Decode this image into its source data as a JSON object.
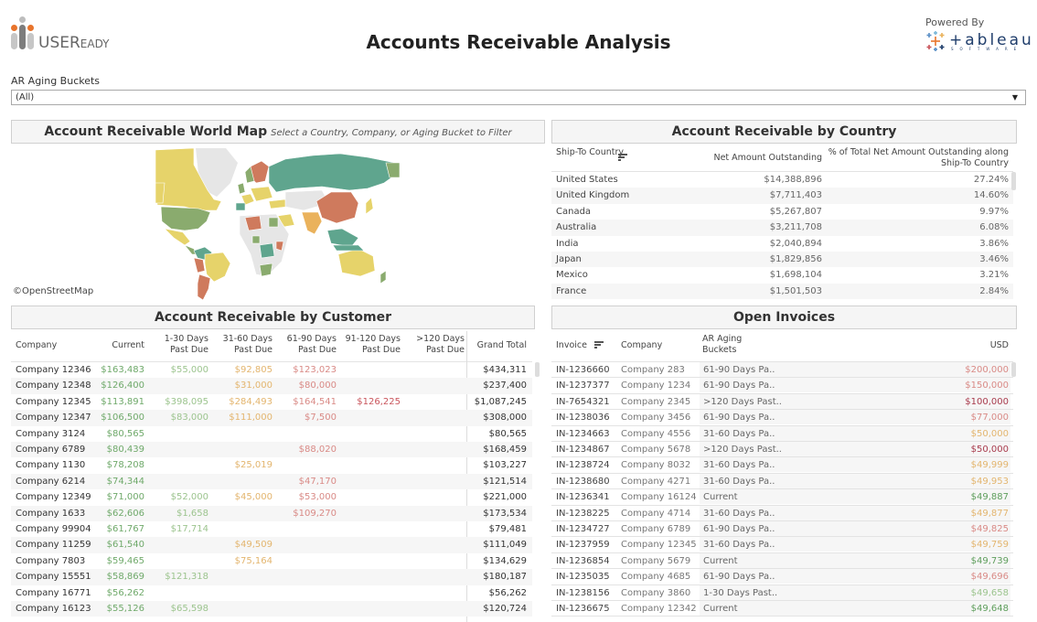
{
  "header": {
    "logo_text_main": "USER",
    "logo_text_small": "EADY",
    "title": "Accounts Receivable Analysis",
    "powered_by": "Powered By",
    "tableau_text": "+ableau",
    "tableau_sub": "SOFTWARE"
  },
  "filter": {
    "label": "AR Aging Buckets",
    "value": "(All)",
    "arrow": "▼"
  },
  "map": {
    "title": "Account Receivable World Map",
    "subtitle": "Select a Country, Company, or Aging Bucket to Filter",
    "credit": "©OpenStreetMap",
    "colors": {
      "current": "#5fa58e",
      "green": "#8aab6e",
      "yellow": "#e6d36a",
      "orange": "#eab25c",
      "red": "#cf7a5d",
      "nodata": "#e6e6e6"
    }
  },
  "country": {
    "title": "Account Receivable by Country",
    "headers": {
      "country": "Ship-To Country",
      "net": "Net Amount Outstanding",
      "pct": "% of Total Net Amount Outstanding along Ship-To Country"
    },
    "rows": [
      {
        "country": "United States",
        "net": "$14,388,896",
        "pct": "27.24%"
      },
      {
        "country": "United Kingdom",
        "net": "$7,711,403",
        "pct": "14.60%"
      },
      {
        "country": "Canada",
        "net": "$5,267,807",
        "pct": "9.97%"
      },
      {
        "country": "Australia",
        "net": "$3,211,708",
        "pct": "6.08%"
      },
      {
        "country": "India",
        "net": "$2,040,894",
        "pct": "3.86%"
      },
      {
        "country": "Japan",
        "net": "$1,829,856",
        "pct": "3.46%"
      },
      {
        "country": "Mexico",
        "net": "$1,698,104",
        "pct": "3.21%"
      },
      {
        "country": "France",
        "net": "$1,501,503",
        "pct": "2.84%"
      }
    ]
  },
  "customer": {
    "title": "Account Receivable by Customer",
    "headers": [
      "Company",
      "Current",
      "1-30 Days Past Due",
      "31-60 Days Past Due",
      "61-90 Days Past Due",
      "91-120 Days Past Due",
      ">120 Days Past Due",
      "Grand Total"
    ],
    "column_colors": [
      "#333333",
      "#6fa96a",
      "#9cc48e",
      "#e3b56e",
      "#d98a86",
      "#c9555c",
      "#a83a4c",
      "#333333"
    ],
    "rows": [
      [
        "Company 12346",
        "$163,483",
        "$55,000",
        "$92,805",
        "$123,023",
        "",
        "",
        "$434,311"
      ],
      [
        "Company 12348",
        "$126,400",
        "",
        "$31,000",
        "$80,000",
        "",
        "",
        "$237,400"
      ],
      [
        "Company 12345",
        "$113,891",
        "$398,095",
        "$284,493",
        "$164,541",
        "$126,225",
        "",
        "$1,087,245"
      ],
      [
        "Company 12347",
        "$106,500",
        "$83,000",
        "$111,000",
        "$7,500",
        "",
        "",
        "$308,000"
      ],
      [
        "Company 3124",
        "$80,565",
        "",
        "",
        "",
        "",
        "",
        "$80,565"
      ],
      [
        "Company 6789",
        "$80,439",
        "",
        "",
        "$88,020",
        "",
        "",
        "$168,459"
      ],
      [
        "Company 1130",
        "$78,208",
        "",
        "$25,019",
        "",
        "",
        "",
        "$103,227"
      ],
      [
        "Company 6214",
        "$74,344",
        "",
        "",
        "$47,170",
        "",
        "",
        "$121,514"
      ],
      [
        "Company 12349",
        "$71,000",
        "$52,000",
        "$45,000",
        "$53,000",
        "",
        "",
        "$221,000"
      ],
      [
        "Company 1633",
        "$62,606",
        "$1,658",
        "",
        "$109,270",
        "",
        "",
        "$173,534"
      ],
      [
        "Company 99904",
        "$61,767",
        "$17,714",
        "",
        "",
        "",
        "",
        "$79,481"
      ],
      [
        "Company 11259",
        "$61,540",
        "",
        "$49,509",
        "",
        "",
        "",
        "$111,049"
      ],
      [
        "Company 7803",
        "$59,465",
        "",
        "$75,164",
        "",
        "",
        "",
        "$134,629"
      ],
      [
        "Company 15551",
        "$58,869",
        "$121,318",
        "",
        "",
        "",
        "",
        "$180,187"
      ],
      [
        "Company 16771",
        "$56,262",
        "",
        "",
        "",
        "",
        "",
        "$56,262"
      ],
      [
        "Company 16123",
        "$55,126",
        "$65,598",
        "",
        "",
        "",
        "",
        "$120,724"
      ]
    ]
  },
  "invoices": {
    "title": "Open Invoices",
    "headers": {
      "invoice": "Invoice",
      "company": "Company",
      "bucket": "AR Aging Buckets",
      "usd": "USD"
    },
    "bucket_colors": {
      "Current": "#5e9e5c",
      "1-30": "#9cc48e",
      "31-60": "#e3b56e",
      "61-90": "#d98a86",
      ">120": "#a83a4c"
    },
    "rows": [
      {
        "invoice": "IN-1236660",
        "company": "Company 283",
        "bucket": "61-90 Days Pa..",
        "usd": "$200,000",
        "key": "61-90"
      },
      {
        "invoice": "IN-1237377",
        "company": "Company 1234",
        "bucket": "61-90 Days Pa..",
        "usd": "$150,000",
        "key": "61-90"
      },
      {
        "invoice": "IN-7654321",
        "company": "Company 2345",
        "bucket": ">120 Days Past..",
        "usd": "$100,000",
        "key": ">120"
      },
      {
        "invoice": "IN-1238036",
        "company": "Company 3456",
        "bucket": "61-90 Days Pa..",
        "usd": "$77,000",
        "key": "61-90"
      },
      {
        "invoice": "IN-1234663",
        "company": "Company 4556",
        "bucket": "31-60 Days Pa..",
        "usd": "$50,000",
        "key": "31-60"
      },
      {
        "invoice": "IN-1234867",
        "company": "Company 5678",
        "bucket": ">120 Days Past..",
        "usd": "$50,000",
        "key": ">120"
      },
      {
        "invoice": "IN-1238724",
        "company": "Company 8032",
        "bucket": "31-60 Days Pa..",
        "usd": "$49,999",
        "key": "31-60"
      },
      {
        "invoice": "IN-1238680",
        "company": "Company 4271",
        "bucket": "31-60 Days Pa..",
        "usd": "$49,953",
        "key": "31-60"
      },
      {
        "invoice": "IN-1236341",
        "company": "Company 16124",
        "bucket": "Current",
        "usd": "$49,887",
        "key": "Current"
      },
      {
        "invoice": "IN-1238225",
        "company": "Company 4714",
        "bucket": "31-60 Days Pa..",
        "usd": "$49,877",
        "key": "31-60"
      },
      {
        "invoice": "IN-1234727",
        "company": "Company 6789",
        "bucket": "61-90 Days Pa..",
        "usd": "$49,825",
        "key": "61-90"
      },
      {
        "invoice": "IN-1237959",
        "company": "Company 12345",
        "bucket": "31-60 Days Pa..",
        "usd": "$49,759",
        "key": "31-60"
      },
      {
        "invoice": "IN-1236854",
        "company": "Company 5679",
        "bucket": "Current",
        "usd": "$49,739",
        "key": "Current"
      },
      {
        "invoice": "IN-1235035",
        "company": "Company 4685",
        "bucket": "61-90 Days Pa..",
        "usd": "$49,696",
        "key": "61-90"
      },
      {
        "invoice": "IN-1238156",
        "company": "Company 3860",
        "bucket": "1-30 Days Past..",
        "usd": "$49,658",
        "key": "1-30"
      },
      {
        "invoice": "IN-1236675",
        "company": "Company 12342",
        "bucket": "Current",
        "usd": "$49,648",
        "key": "Current"
      }
    ]
  }
}
